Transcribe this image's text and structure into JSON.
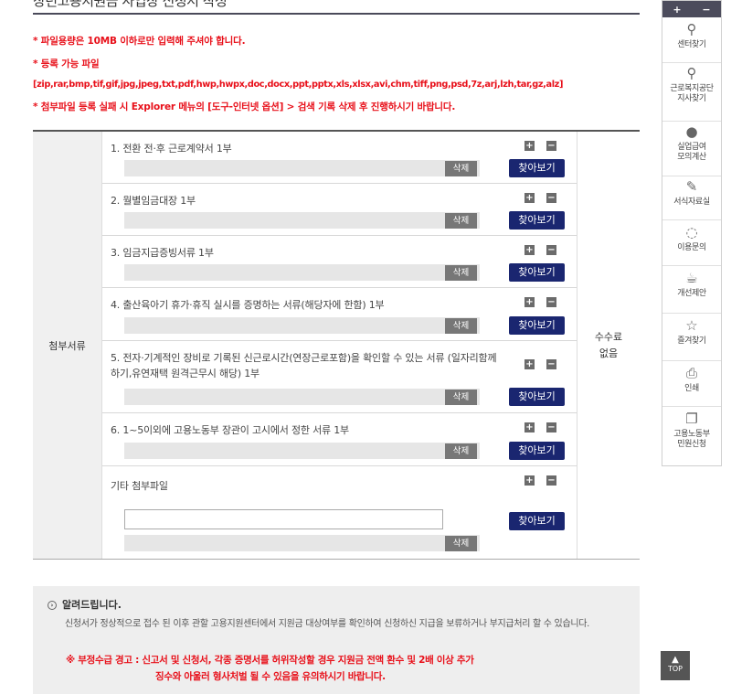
{
  "page": {
    "title": "장년고용지원금 사업장 신청서 작성"
  },
  "notices": {
    "size_limit": "* 파일용량은 10MB 이하로만 입력해 주셔야 합니다.",
    "allowed_label": "* 등록 가능 파일",
    "allowed_types": "[zip,rar,bmp,tif,gif,jpg,jpeg,txt,pdf,hwp,hwpx,doc,docx,ppt,pptx,xls,xlsx,avi,chm,tiff,png,psd,7z,arj,lzh,tar,gz,alz]",
    "failure_hint": "* 첨부파일 등록 실패 시 Explorer 메뉴의 [도구-인터넷 옵션] > 검색 기록 삭제 후 진행하시기 바랍니다."
  },
  "attachments": {
    "section_label": "첨부서류",
    "fee_line1": "수수료",
    "fee_line2": "없음",
    "delete_label": "삭제",
    "browse_label": "찾아보기",
    "plus_label": "+",
    "minus_label": "−",
    "items": [
      {
        "title": "1. 전환 전·후 근로계약서 1부"
      },
      {
        "title": "2. 월별임금대장 1부"
      },
      {
        "title": "3. 임금지급증빙서류 1부"
      },
      {
        "title": "4. 출산육아기 휴가·휴직 실시를 증명하는 서류(해당자에 한함) 1부"
      },
      {
        "title": "5. 전자·기계적인 장비로 기록된 신근로시간(연장근로포함)을 확인할 수 있는 서류 (일자리함께하기,유연재택 원격근무시 해당) 1부"
      },
      {
        "title": "6. 1~5이외에 고용노동부 장관이 고시에서 정한 서류 1부"
      },
      {
        "title": "기타 첨부파일"
      }
    ]
  },
  "info": {
    "heading": "알려드립니다.",
    "body": "신청서가 정상적으로 접수 된 이후 관할 고용지원센터에서 지원금 대상여부를 확인하여 신청하신 지급을 보류하거나 부지급처리 할 수 있습니다.",
    "warning_line1": "※ 부정수급 경고 : 신고서 및 신청서, 각종 증명서를 허위작성할 경우 지원금 전액 환수 및 2배 이상 추가",
    "warning_line2": "징수와 아울러 형사처벌 될 수 있음을 유의하시기 바랍니다."
  },
  "quick_menu": {
    "plus": "+",
    "minus": "−",
    "items": [
      {
        "icon": "location-pin-icon",
        "glyph": "⚲",
        "label": "센터찾기"
      },
      {
        "icon": "location-pin-icon",
        "glyph": "⚲",
        "label": "근로복지공단\n지사찾기"
      },
      {
        "icon": "person-icon",
        "glyph": "👤",
        "label": "실업급여\n모의계산"
      },
      {
        "icon": "edit-icon",
        "glyph": "✎",
        "label": "서식자료실"
      },
      {
        "icon": "chat-icon",
        "glyph": "💬",
        "label": "이용문의"
      },
      {
        "icon": "cup-icon",
        "glyph": "☕",
        "label": "개선제안"
      },
      {
        "icon": "star-icon",
        "glyph": "☆",
        "label": "즐겨찾기"
      },
      {
        "icon": "print-icon",
        "glyph": "⎙",
        "label": "인쇄"
      },
      {
        "icon": "document-icon",
        "glyph": "🗐",
        "label": "고용노동부\n민원신청"
      }
    ]
  },
  "top_button": {
    "label": "TOP"
  }
}
